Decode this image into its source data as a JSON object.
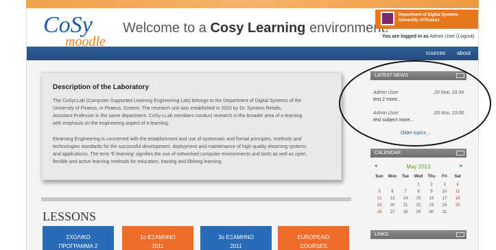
{
  "header": {
    "welcome_prefix": "Welcome to a",
    "welcome_bold": "Cosy Learning",
    "welcome_suffix": "environment!",
    "logo_top": "CoSy",
    "logo_bottom": "moodle",
    "dept_line1": "Department of Digital Systems",
    "dept_line2": "University of Piraeus",
    "login_text": "You are logged in as",
    "login_user": "Admin User",
    "logout": "(Logout)"
  },
  "nav": {
    "courses": "cources",
    "about": "about"
  },
  "description": {
    "title": "Description of the Laboratory",
    "para1_l1": "The CoSyLLab (Computer Supported Learning Engineering Lab) belongs to the Department of Digital Systems of the",
    "para1_l2": "University of Piraeus, in Piraeus, Greece. The research unit was established in 2003 by Dr. Symeon Retalis,",
    "para1_l3": "Assistant Professor in the same department. CoSy-LLab members conduct research in the broader area of e-learning",
    "para1_l4": "with emphasis on the engineering aspect of e-learning.",
    "para2_l1": "Elearning Engineering is concerned with the establishment and use of systematic and formal principles, methods and",
    "para2_l2": "technologies standards for the successful development, deployment and maintenance of high quality elearning systems",
    "para2_l3": "and applications. The term 'E-learning' signifies the use of networked computer environments and tools as well as open,",
    "para2_l4": "flexible and active learning methods for education, training and lifelong learning."
  },
  "lessons": {
    "title": "LESSONS",
    "tiles": [
      {
        "l1": "ΣΧΟΛΙΚΟ",
        "l2": "ΠΡΟΓΡΑΜΜΑ 2",
        "color": "#2a6bb8"
      },
      {
        "l1": "1ο ΕΞΑΜΗΝΟ",
        "l2": "2011",
        "color": "#ee6b2a"
      },
      {
        "l1": "3ο ΕΞΑΜΗΝΟ",
        "l2": "2011",
        "color": "#2a6bb8"
      },
      {
        "l1": "EUROPEAID",
        "l2": "COURSES",
        "color": "#ee6b2a"
      }
    ]
  },
  "news": {
    "title": "LATEST NEWS",
    "items": [
      {
        "who": "Admin User",
        "when": "20 Nov, 10:34",
        "subject": "test 2 more..."
      },
      {
        "who": "Admin User",
        "when": "20 Nov, 10:06",
        "subject": "test subject more..."
      }
    ],
    "older": "Older topics ..."
  },
  "calendar": {
    "title": "CALENDAR",
    "month": "May 2013",
    "prev": "◄",
    "next": "►",
    "days": [
      "Sun",
      "Mon",
      "Tue",
      "Wed",
      "Thu",
      "Fri",
      "Sat"
    ],
    "weeks": [
      [
        "",
        "",
        "",
        "1",
        "2",
        "3",
        "4"
      ],
      [
        "5",
        "6",
        "7",
        "8",
        "9",
        "10",
        "11"
      ],
      [
        "12",
        "13",
        "14",
        "15",
        "16",
        "17",
        "18"
      ],
      [
        "19",
        "20",
        "21",
        "22",
        "23",
        "24",
        "25"
      ],
      [
        "26",
        "27",
        "28",
        "29",
        "30",
        "31",
        ""
      ]
    ]
  },
  "links": {
    "title": "LINKS"
  },
  "colors": {
    "brand_blue": "#2f5e98",
    "accent_orange": "#e8781e",
    "annotation": "#111111"
  }
}
